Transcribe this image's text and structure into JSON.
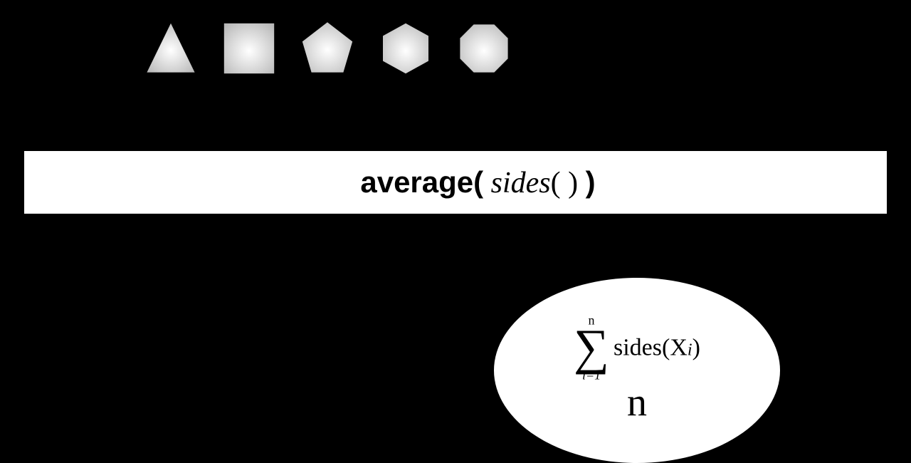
{
  "shapes": [
    {
      "name": "triangle",
      "sides": 3
    },
    {
      "name": "square",
      "sides": 4
    },
    {
      "name": "pentagon",
      "sides": 5
    },
    {
      "name": "hexagon",
      "sides": 6
    },
    {
      "name": "octagon",
      "sides": 8
    }
  ],
  "banner": {
    "avg_open": "average(",
    "sides_fn": " sides",
    "sides_par": "( ) ",
    "avg_close": ")"
  },
  "formula": {
    "sum_upper": "n",
    "sum_lower": "i=1",
    "sides_word": "sides",
    "x_sym": "X",
    "i_sym": "i",
    "denominator": "n"
  }
}
